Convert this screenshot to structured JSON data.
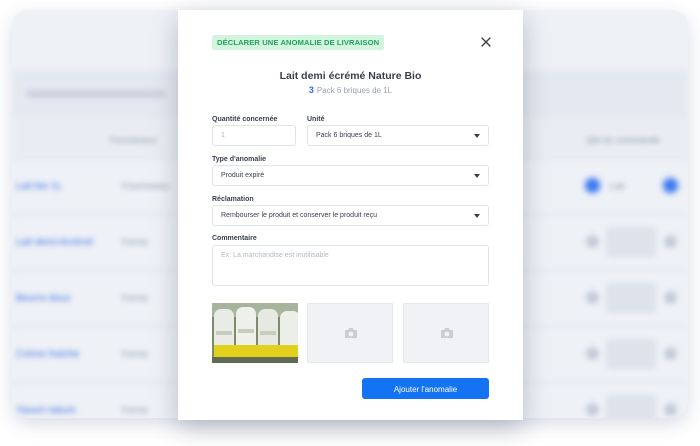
{
  "background": {
    "headers": [
      "Fournisseur",
      "Qté du commande"
    ],
    "rows": [
      {
        "name": "Lait bio 1L",
        "supplier": "Fournisseur"
      },
      {
        "name": "Lait demi-écrémé",
        "supplier": "Ferme"
      },
      {
        "name": "Beurre doux",
        "supplier": "Ferme"
      },
      {
        "name": "Crème fraîche",
        "supplier": "Ferme"
      },
      {
        "name": "Yaourt nature",
        "supplier": "Ferme"
      }
    ],
    "first_row_value": "Lait"
  },
  "modal": {
    "badge": "DÉCLARER UNE ANOMALIE DE LIVRAISON",
    "close_icon": "close-icon",
    "product_title": "Lait demi écrémé Nature Bio",
    "quantity": "3",
    "pack_label": "Pack 6 briques de 1L",
    "fields": {
      "quantity_label": "Quantité concernée",
      "quantity_placeholder": "1",
      "unit_label": "Unité",
      "unit_value": "Pack 6 briques de 1L",
      "anomaly_label": "Type d'anomalie",
      "anomaly_value": "Produit expiré",
      "claim_label": "Réclamation",
      "claim_value": "Rembourser le produit et conserver le produit reçu",
      "comment_label": "Commentaire",
      "comment_placeholder": "Ex. La marchandise est inutilisable"
    },
    "photo_slots": [
      "photo",
      "camera-icon",
      "camera-icon"
    ],
    "submit_label": "Ajouter l'anomalie",
    "colors": {
      "accent": "#1473f2",
      "badge_bg": "#d3f5df",
      "badge_text": "#21a35a"
    }
  }
}
